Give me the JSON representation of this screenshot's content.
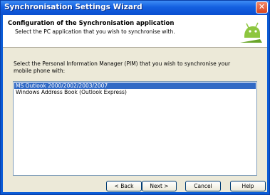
{
  "window": {
    "title": "Synchronisation Settings Wizard",
    "close_label": "✕"
  },
  "header": {
    "title": "Configuration of the Synchronisation application",
    "subtitle": "Select the PC application that you wish to synchronise with."
  },
  "prompt": "Select the Personal Information Manager (PIM) that you wish to synchronise your mobile phone with:",
  "pim_list": {
    "items": [
      "MS Outlook 2000/2002/2003/2007",
      "Windows Address Book (Outlook Express)"
    ],
    "selected_index": 0
  },
  "buttons": {
    "back": "< Back",
    "next": "Next >",
    "cancel": "Cancel",
    "help": "Help"
  },
  "icons": {
    "logo": "android-robot-icon",
    "close": "close-icon"
  },
  "colors": {
    "titlebar": "#0a5bd6",
    "selection": "#316ac5",
    "logo_green": "#8dc63f"
  }
}
